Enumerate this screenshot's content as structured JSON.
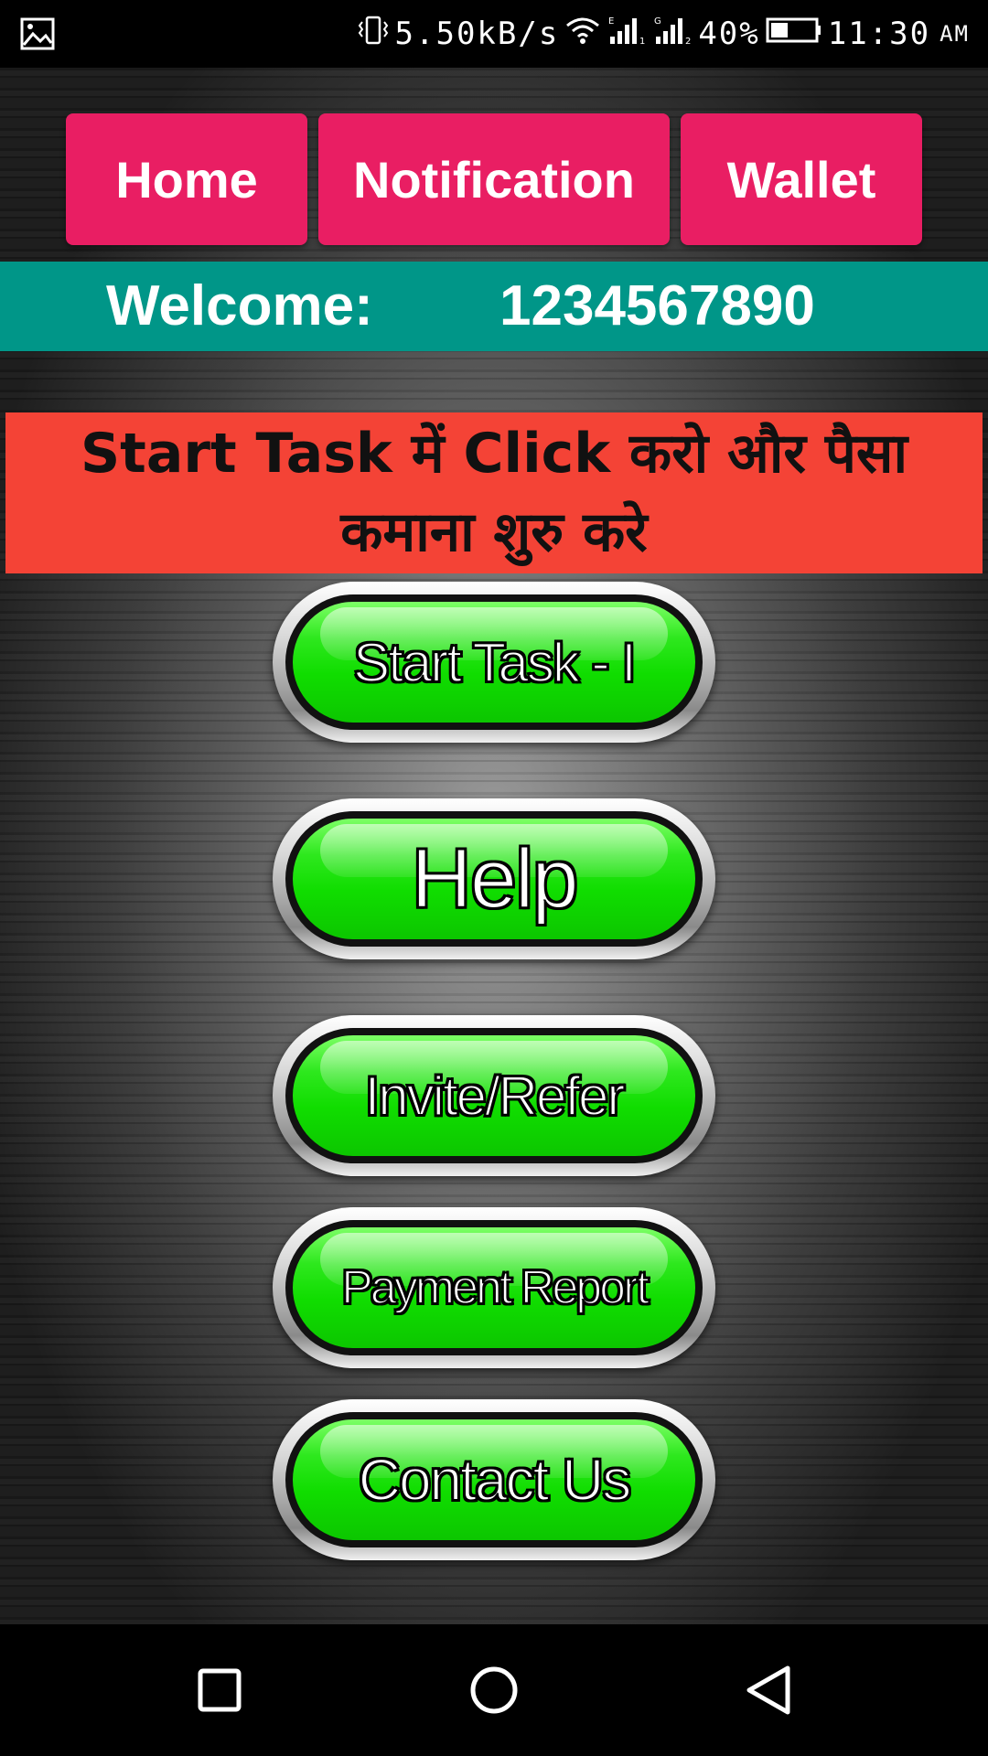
{
  "status_bar": {
    "speed": "5.50kB/s",
    "battery": "40%",
    "time": "11:30",
    "ampm": "AM",
    "icons": [
      "gallery-icon",
      "vibrate-icon",
      "wifi-icon",
      "signal-e-icon",
      "signal-g-icon",
      "battery-icon"
    ]
  },
  "nav": {
    "home": "Home",
    "notification": "Notification",
    "wallet": "Wallet"
  },
  "welcome": {
    "label": "Welcome:",
    "value": "1234567890"
  },
  "banner": {
    "text": "Start Task में Click करो और पैसा कमाना शुरु करे"
  },
  "buttons": {
    "start_task": "Start Task - I",
    "help": "Help",
    "invite": "Invite/Refer",
    "payment": "Payment Report",
    "contact": "Contact Us"
  },
  "colors": {
    "nav_button": "#e91e63",
    "welcome_bar": "#009688",
    "banner": "#f44336",
    "green_button": "#10dd00"
  },
  "system_nav": {
    "icons": [
      "recent-apps-icon",
      "home-circle-icon",
      "back-triangle-icon"
    ]
  }
}
